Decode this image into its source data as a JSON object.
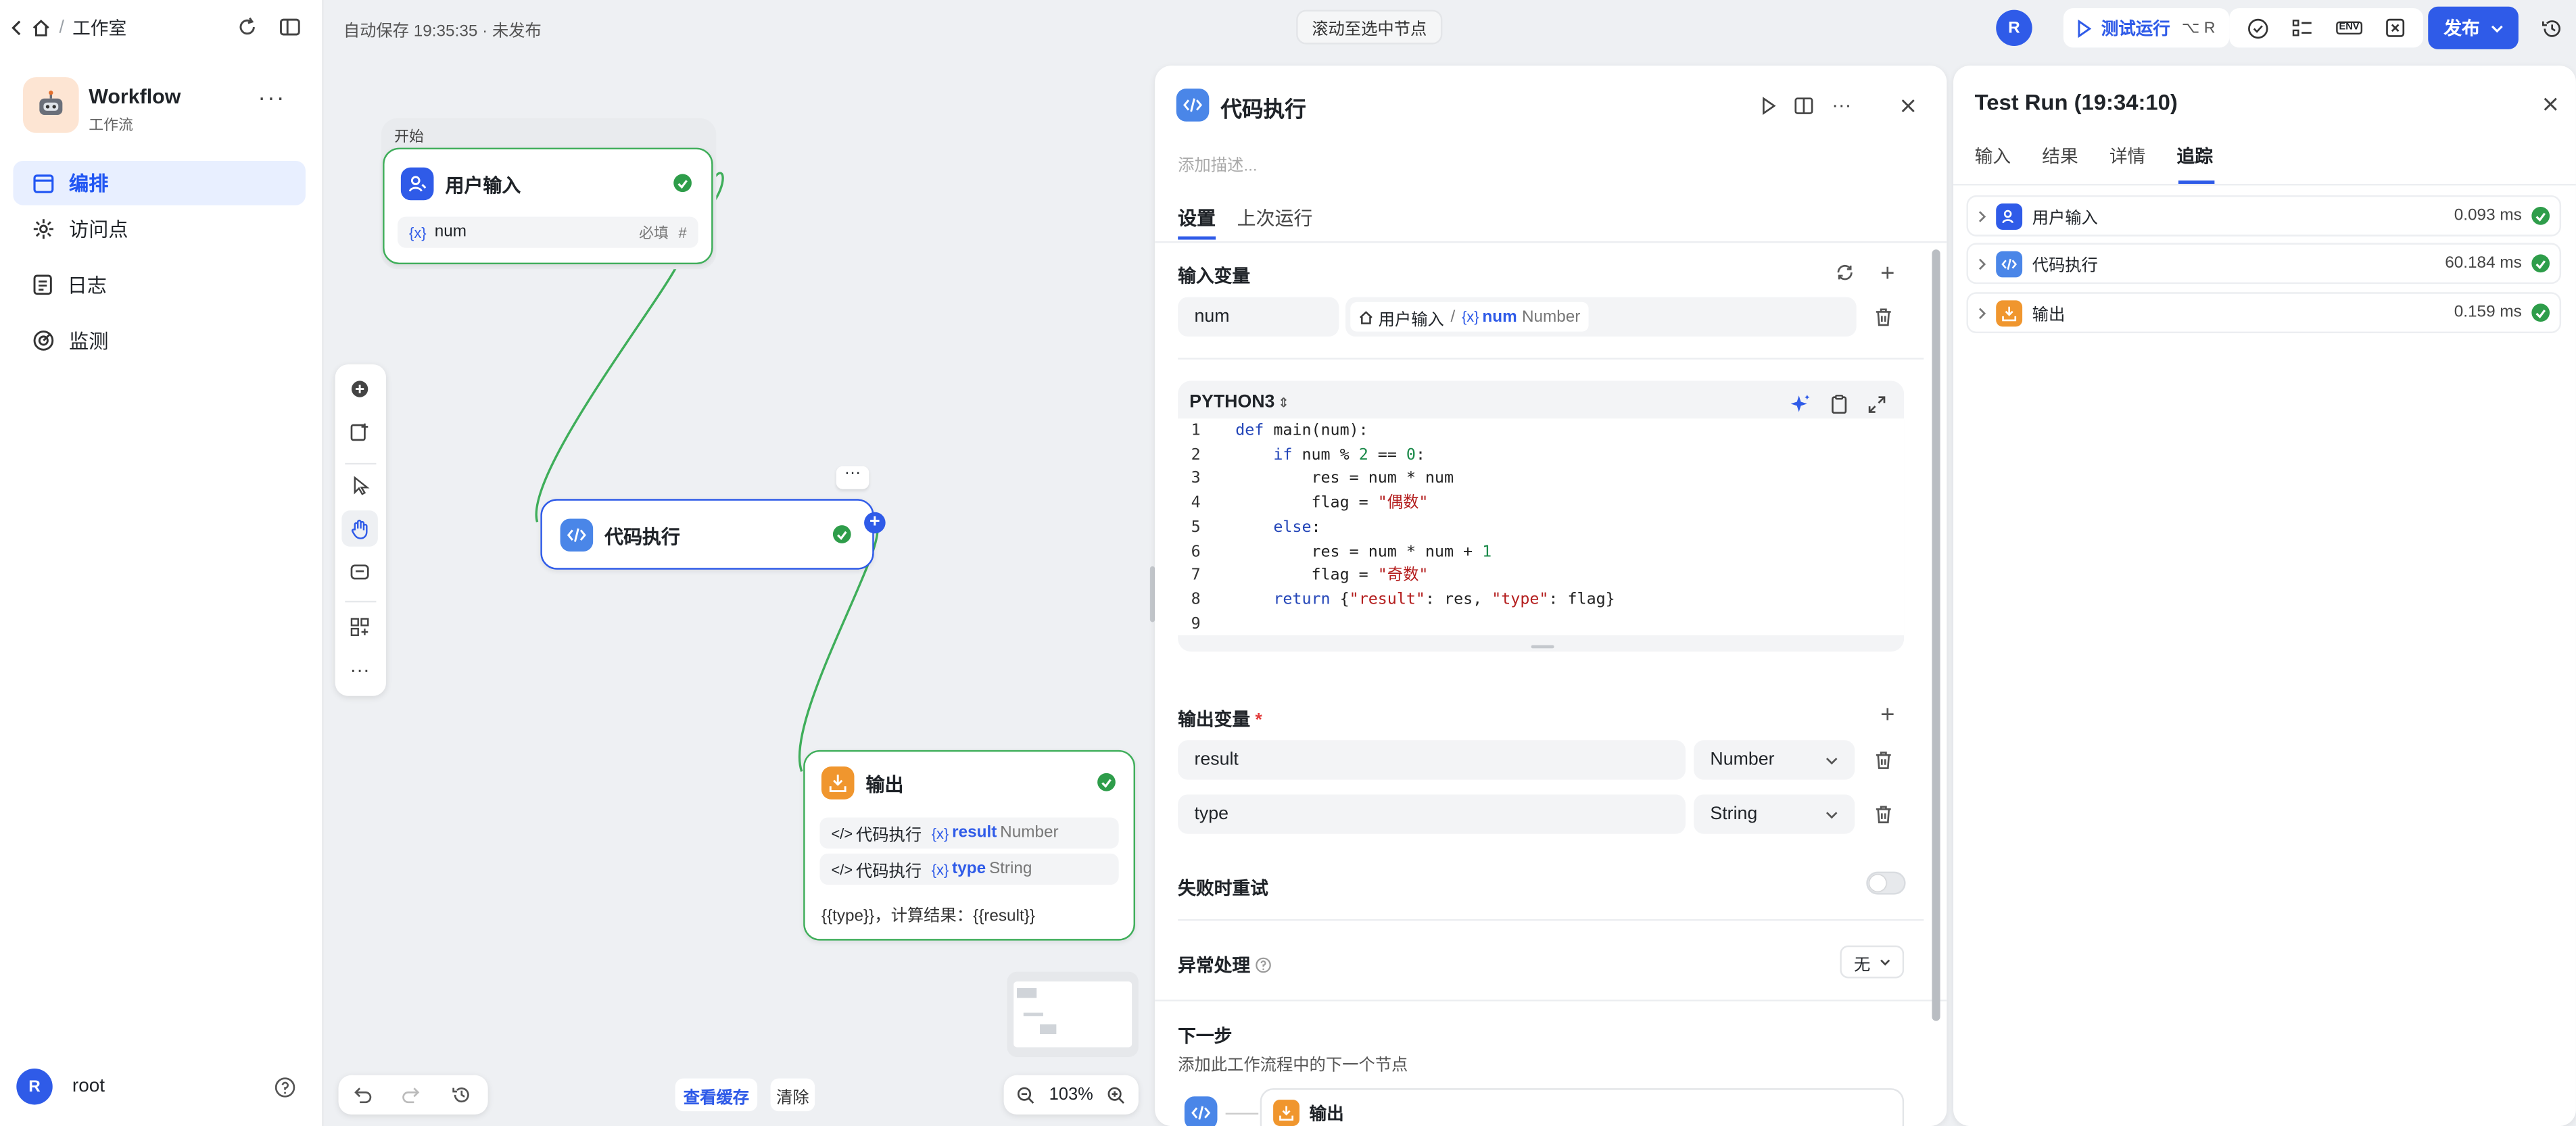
{
  "breadcrumb": {
    "current": "工作室"
  },
  "app": {
    "name": "Workflow",
    "type": "工作流"
  },
  "sidebar": {
    "items": [
      {
        "label": "编排",
        "icon": "layout-icon",
        "active": true
      },
      {
        "label": "访问点",
        "icon": "access-point-icon",
        "active": false
      },
      {
        "label": "日志",
        "icon": "log-icon",
        "active": false
      },
      {
        "label": "监测",
        "icon": "monitor-icon",
        "active": false
      }
    ],
    "user": {
      "initial": "R",
      "name": "root"
    }
  },
  "topbar": {
    "autosave": "自动保存 19:35:35 · 未发布",
    "scroll_to_node": "滚动至选中节点",
    "user_initial": "R",
    "test_run": "测试运行",
    "shortcut": "⌥ R",
    "env": "ENV",
    "publish": "发布"
  },
  "canvas": {
    "start_group_label": "开始",
    "nodes": {
      "user_input": {
        "title": "用户输入",
        "var": "num",
        "required": "必填",
        "type_glyph": "#"
      },
      "code": {
        "title": "代码执行",
        "more": "···"
      },
      "output": {
        "title": "输出",
        "rows": [
          {
            "source": "代码执行",
            "var": "result",
            "type": "Number"
          },
          {
            "source": "代码执行",
            "var": "type",
            "type": "String"
          }
        ],
        "template": "{{type}}，计算结果：{{result}}"
      }
    },
    "bottom": {
      "view_cache": "查看缓存",
      "clear": "清除",
      "zoom": "103%"
    }
  },
  "panel": {
    "title": "代码执行",
    "desc_placeholder": "添加描述...",
    "tabs": [
      "设置",
      "上次运行"
    ],
    "input_section": "输入变量",
    "input_var": {
      "name": "num",
      "source_node": "用户输入",
      "var": "num",
      "type": "Number"
    },
    "language": "PYTHON3",
    "code_lines": [
      "1",
      "2",
      "3",
      "4",
      "5",
      "6",
      "7",
      "8",
      "9"
    ],
    "output_section": "输出变量",
    "required_mark": "*",
    "outputs": [
      {
        "name": "result",
        "type": "Number"
      },
      {
        "name": "type",
        "type": "String"
      }
    ],
    "retry": "失败时重试",
    "error_handling": "异常处理",
    "error_value": "无",
    "next_step": "下一步",
    "next_step_desc": "添加此工作流程中的下一个节点",
    "next_node": "输出"
  },
  "testrun": {
    "title": "Test Run (19:34:10)",
    "tabs": [
      "输入",
      "结果",
      "详情",
      "追踪"
    ],
    "active_tab": 3,
    "rows": [
      {
        "name": "用户输入",
        "time": "0.093 ms",
        "color": "#2f5be8"
      },
      {
        "name": "代码执行",
        "time": "60.184 ms",
        "color": "#4a86e8"
      },
      {
        "name": "输出",
        "time": "0.159 ms",
        "color": "#f0962e"
      }
    ]
  }
}
